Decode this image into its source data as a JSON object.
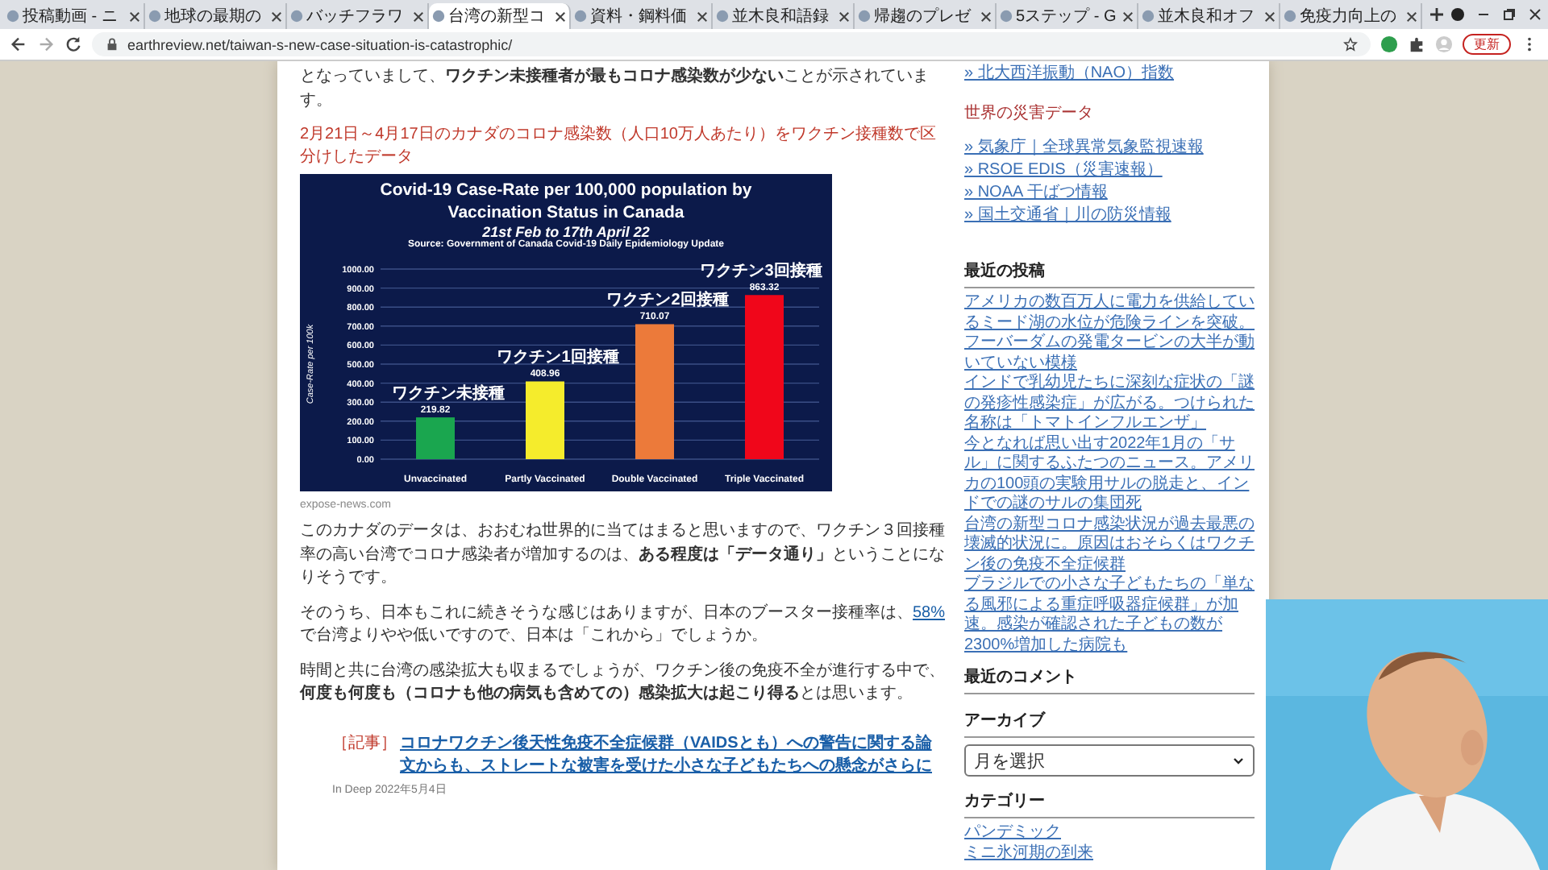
{
  "browser": {
    "tabs": [
      {
        "title": "投稿動画 - ニ",
        "selected": false
      },
      {
        "title": "地球の最期の",
        "selected": false
      },
      {
        "title": "バッチフラワ",
        "selected": false
      },
      {
        "title": "台湾の新型コ",
        "selected": true
      },
      {
        "title": "資料・鋼料価",
        "selected": false
      },
      {
        "title": "並木良和語録",
        "selected": false
      },
      {
        "title": "帰趨のプレゼ",
        "selected": false
      },
      {
        "title": "5ステップ - G",
        "selected": false
      },
      {
        "title": "並木良和オフ",
        "selected": false
      },
      {
        "title": "免疫力向上の",
        "selected": false
      }
    ],
    "url": "earthreview.net/taiwan-s-new-case-situation-is-catastrophic/",
    "update_button": "更新"
  },
  "article": {
    "intro": "となっていまして、**ワクチン未接種者が最もコロナ感染数が少ない**ことが示されています。",
    "caption": "2月21日～4月17日のカナダのコロナ感染数（人口10万人あたり）をワクチン接種数で区分けしたデータ",
    "chart": {
      "subtitle": "21st Feb to 17th April 22",
      "source": "Source: Government of Canada Covid-19 Daily Epidemiology Update",
      "chart_data": {
        "type": "bar",
        "title": "Covid-19 Case-Rate per 100,000 population by Vaccination Status in Canada",
        "ylabel": "Case-Rate per 100k",
        "categories": [
          "Unvaccinated",
          "Partly Vaccinated",
          "Double Vaccinated",
          "Triple Vaccinated"
        ],
        "series": [
          {
            "name": "ワクチン未接種",
            "color": "#1aa64f",
            "values": [
              219.82,
              null,
              null,
              null
            ]
          },
          {
            "name": "ワクチン1回接種",
            "color": "#f5ec2c",
            "values": [
              null,
              408.96,
              null,
              null
            ]
          },
          {
            "name": "ワクチン2回接種",
            "color": "#ec7a3a",
            "values": [
              null,
              null,
              710.07,
              null
            ]
          },
          {
            "name": "ワクチン3回接種",
            "color": "#f0061a",
            "values": [
              null,
              null,
              null,
              863.32
            ]
          }
        ],
        "stacked": true,
        "grid": true,
        "ylim": [
          0,
          1000
        ],
        "yticks": [
          {
            "value": 0,
            "label": "0.00"
          },
          {
            "value": 100,
            "label": "100.00"
          },
          {
            "value": 200,
            "label": "200.00"
          },
          {
            "value": 300,
            "label": "300.00"
          },
          {
            "value": 400,
            "label": "400.00"
          },
          {
            "value": 500,
            "label": "500.00"
          },
          {
            "value": 600,
            "label": "600.00"
          },
          {
            "value": 700,
            "label": "700.00"
          },
          {
            "value": 800,
            "label": "800.00"
          },
          {
            "value": 900,
            "label": "900.00"
          },
          {
            "value": 1000,
            "label": "1000.00"
          }
        ],
        "data_labels": true
      }
    },
    "image_source": "expose-news.com",
    "paragraphs": [
      {
        "parts": [
          {
            "text": "このカナダのデータは、おおむね世界的に当てはまると思いますので、ワクチン３回接種率の高い台湾でコロナ感染者が増加するのは、**ある程度は「データ通り」**ということになりそうです。",
            "link": false
          }
        ]
      },
      {
        "parts": [
          {
            "text": "そのうち、日本もこれに続きそうな感じはありますが、日本のブースター接種率は、",
            "link": false
          },
          {
            "text": "58%",
            "link": true
          },
          {
            "text": "で台湾よりやや低いですので、日本は「これから」でしょうか。",
            "link": false
          }
        ]
      },
      {
        "parts": [
          {
            "text": "時間と共に台湾の感染拡大も収まるでしょうが、ワクチン後の免疫不全が進行する中で、**何度も何度も（コロナも他の病気も含めての）感染拡大は起こり得る**とは思います。",
            "link": false
          }
        ]
      }
    ],
    "related": {
      "tag": "［記事］",
      "title": "コロナワクチン後天性免疫不全症候群（VAIDSとも）への警告に関する論文からも、ストレートな被害を受けた小さな子どもたちへの懸念がさらに",
      "meta": "In Deep 2022年5月4日"
    }
  },
  "sidebar": {
    "cut_link": "» 北大西洋振動（NAO）指数",
    "disaster_heading": "世界の災害データ",
    "disaster_links": [
      "» 気象庁｜全球異常気象監視速報",
      "» RSOE EDIS（災害速報）",
      "» NOAA 干ばつ情報",
      "» 国土交通省｜川の防災情報"
    ],
    "recent_heading": "最近の投稿",
    "recent_posts": [
      "アメリカの数百万人に電力を供給しているミード湖の水位が危険ラインを突破。フーバーダムの発電タービンの大半が動いていない模様",
      "インドで乳幼児たちに深刻な症状の「謎の発疹性感染症」が広がる。つけられた名称は「トマトインフルエンザ」",
      "今となれば思い出す2022年1月の「サル」に関するふたつのニュース。アメリカの100頭の実験用サルの脱走と、インドでの謎のサルの集団死",
      "台湾の新型コロナ感染状況が過去最悪の壊滅的状況に。原因はおそらくはワクチン後の免疫不全症候群",
      "ブラジルでの小さな子どもたちの「単なる風邪による重症呼吸器症候群」が加速。感染が確認された子どもの数が2300%増加した病院も"
    ],
    "comments_heading": "最近のコメント",
    "archive_heading": "アーカイブ",
    "archive_select": "月を選択",
    "category_heading": "カテゴリー",
    "categories": [
      "パンデミック",
      "ミニ氷河期の到来"
    ]
  }
}
